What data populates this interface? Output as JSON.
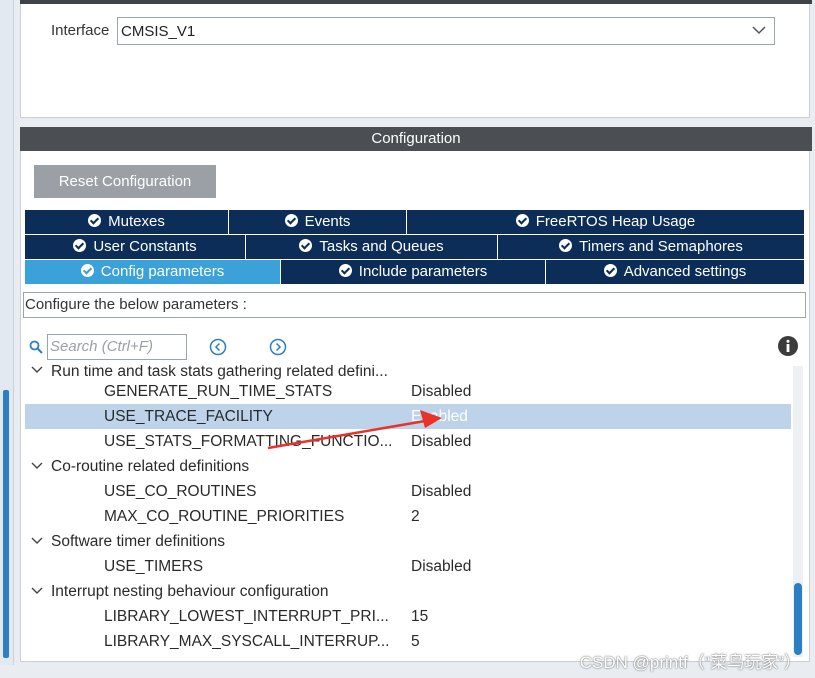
{
  "interface": {
    "label": "Interface",
    "value": "CMSIS_V1"
  },
  "configuration": {
    "header": "Configuration",
    "reset_button": "Reset Configuration",
    "tabs_row1": [
      "Mutexes",
      "Events",
      "FreeRTOS Heap Usage"
    ],
    "tabs_row2": [
      "User Constants",
      "Tasks and Queues",
      "Timers and Semaphores"
    ],
    "tabs_row3": [
      "Config parameters",
      "Include parameters",
      "Advanced settings"
    ],
    "active_tab": "Config parameters",
    "description": "Configure the below parameters :",
    "search_placeholder": "Search (Ctrl+F)"
  },
  "tree": {
    "group_partial": "Run time and task stats gathering related defini...",
    "rows": [
      {
        "param": "GENERATE_RUN_TIME_STATS",
        "value": "Disabled"
      },
      {
        "param": "USE_TRACE_FACILITY",
        "value": "Enabled"
      },
      {
        "param": "USE_STATS_FORMATTING_FUNCTIO...",
        "value": "Disabled"
      }
    ],
    "group2": "Co-routine related definitions",
    "rows2": [
      {
        "param": "USE_CO_ROUTINES",
        "value": "Disabled"
      },
      {
        "param": "MAX_CO_ROUTINE_PRIORITIES",
        "value": "2"
      }
    ],
    "group3": "Software timer definitions",
    "rows3": [
      {
        "param": "USE_TIMERS",
        "value": "Disabled"
      }
    ],
    "group4": "Interrupt nesting behaviour configuration",
    "rows4": [
      {
        "param": "LIBRARY_LOWEST_INTERRUPT_PRI...",
        "value": "15"
      },
      {
        "param": "LIBRARY_MAX_SYSCALL_INTERRUP...",
        "value": "5"
      }
    ]
  },
  "watermark": "CSDN @printf（“菜鸟玩家”）",
  "colors": {
    "tab_bg": "#0c2d57",
    "tab_active": "#3ba1d9",
    "selected_row": "#bcd3ea",
    "annotation_arrow": "#e8332a"
  }
}
